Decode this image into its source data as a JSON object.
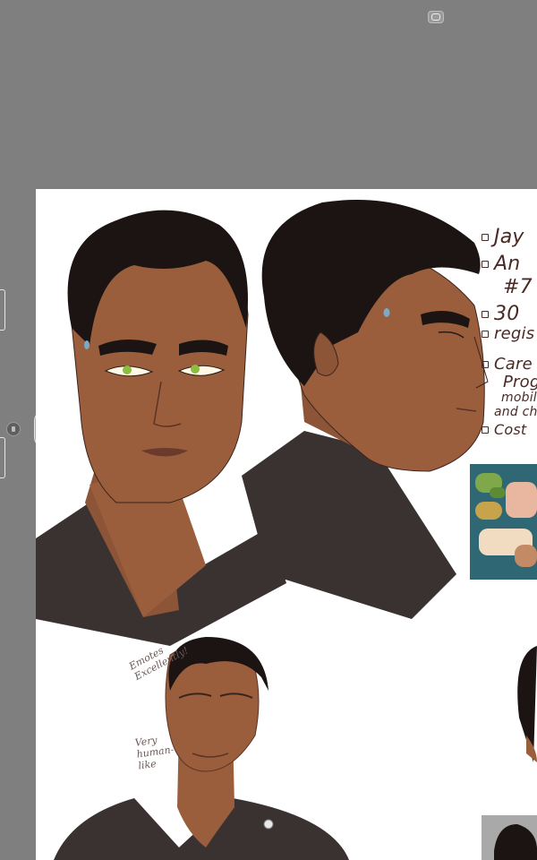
{
  "notes": [
    {
      "text": "Jay"
    },
    {
      "text": "An"
    },
    {
      "text": "#7"
    },
    {
      "text": "30"
    },
    {
      "text": "regis"
    },
    {
      "text": "Care"
    },
    {
      "text": "Prog"
    },
    {
      "text": "mobil"
    },
    {
      "text": "and ch"
    },
    {
      "text": "Cost"
    }
  ],
  "annotations": {
    "emotes": "Emotes Excellently!",
    "very_human": "Very human-like"
  },
  "colors": {
    "background": "#7f7f7f",
    "canvas": "#ffffff",
    "hair": "#1b1413",
    "skin": "#9a5e3d",
    "shirt": "#3a3231",
    "eyes": "#8bbd3e",
    "palette_bg": "#2f6774"
  }
}
